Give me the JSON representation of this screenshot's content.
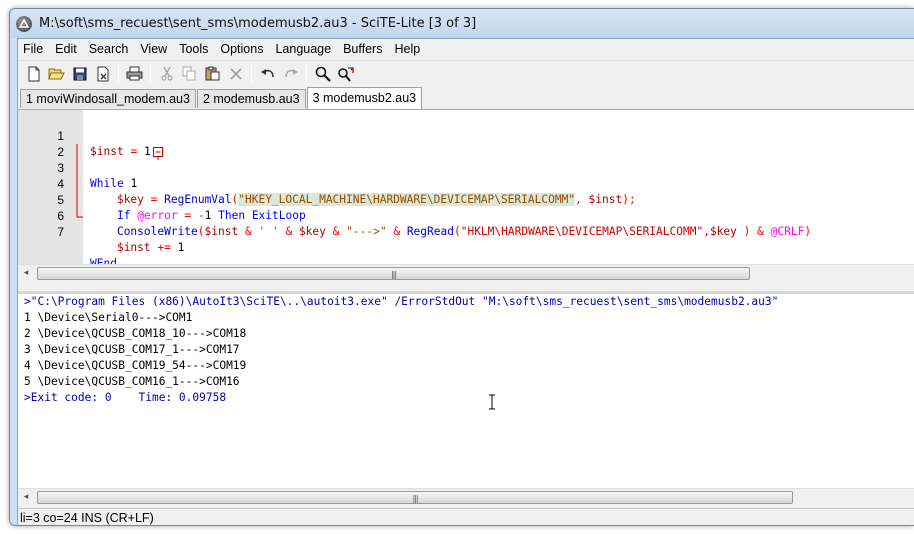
{
  "window": {
    "title": "M:\\soft\\sms_recuest\\sent_sms\\modemusb2.au3 - SciTE-Lite [3 of 3]",
    "accent": "#cfe0f2"
  },
  "menu": [
    "File",
    "Edit",
    "Search",
    "View",
    "Tools",
    "Options",
    "Language",
    "Buffers",
    "Help"
  ],
  "toolbar": {
    "icons": [
      "new-file-icon",
      "open-folder-icon",
      "save-icon",
      "close-file-icon",
      "print-icon",
      "cut-icon",
      "copy-icon",
      "paste-icon",
      "delete-icon",
      "undo-icon",
      "redo-icon",
      "find-icon",
      "replace-icon"
    ]
  },
  "tabs": [
    {
      "label": "1 moviWindosall_modem.au3",
      "active": false
    },
    {
      "label": "2 modemusb.au3",
      "active": false
    },
    {
      "label": "3 modemusb2.au3",
      "active": true
    }
  ],
  "editor": {
    "line_numbers": [
      "1",
      "2",
      "3",
      "4",
      "5",
      "6",
      "7"
    ]
  },
  "output": {
    "command": ">\"C:\\Program Files (x86)\\AutoIt3\\SciTE\\..\\autoit3.exe\" /ErrorStdOut \"M:\\soft\\sms_recuest\\sent_sms\\modemusb2.au3\"",
    "lines": [
      "1 \\Device\\Serial0--->COM1",
      "2 \\Device\\QCUSB_COM18_10--->COM18",
      "3 \\Device\\QCUSB_COM17_1--->COM17",
      "4 \\Device\\QCUSB_COM19_54--->COM19",
      "5 \\Device\\QCUSB_COM16_1--->COM16"
    ],
    "exit": ">Exit code: 0    Time: 0.09758"
  },
  "status": {
    "text": "li=3 co=24 INS (CR+LF)"
  }
}
